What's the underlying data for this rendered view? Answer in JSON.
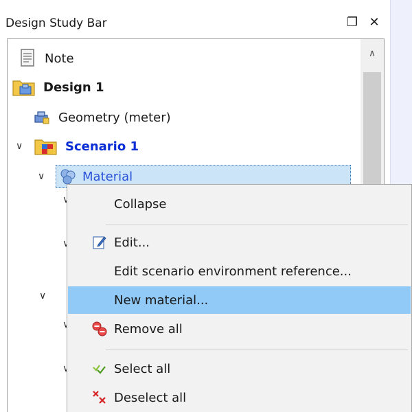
{
  "panel": {
    "title": "Design Study Bar",
    "pin_glyph": "❐",
    "close_glyph": "✕"
  },
  "tree": {
    "items": [
      {
        "label": "Note",
        "icon": "note-icon"
      },
      {
        "label": "Design 1",
        "icon": "design-folder-icon"
      },
      {
        "label": "Geometry (meter)",
        "icon": "geometry-icon"
      },
      {
        "label": "Scenario 1",
        "icon": "scenario-folder-icon"
      },
      {
        "label": "Material",
        "icon": "material-icon"
      }
    ],
    "chevron_down": "∨",
    "chevron_up": "∧"
  },
  "context_menu": {
    "items": [
      {
        "label": "Collapse",
        "icon": ""
      },
      {
        "label": "Edit...",
        "icon": "edit-icon"
      },
      {
        "label": "Edit scenario environment reference...",
        "icon": ""
      },
      {
        "label": "New material...",
        "icon": ""
      },
      {
        "label": "Remove all",
        "icon": "remove-all-icon"
      },
      {
        "label": "Select all",
        "icon": "select-all-icon"
      },
      {
        "label": "Deselect all",
        "icon": "deselect-all-icon"
      }
    ],
    "highlighted_index": 3
  },
  "colors": {
    "highlight": "#91c9f7",
    "selection": "#cce4f7",
    "scenario_text": "#0a2dd6"
  }
}
